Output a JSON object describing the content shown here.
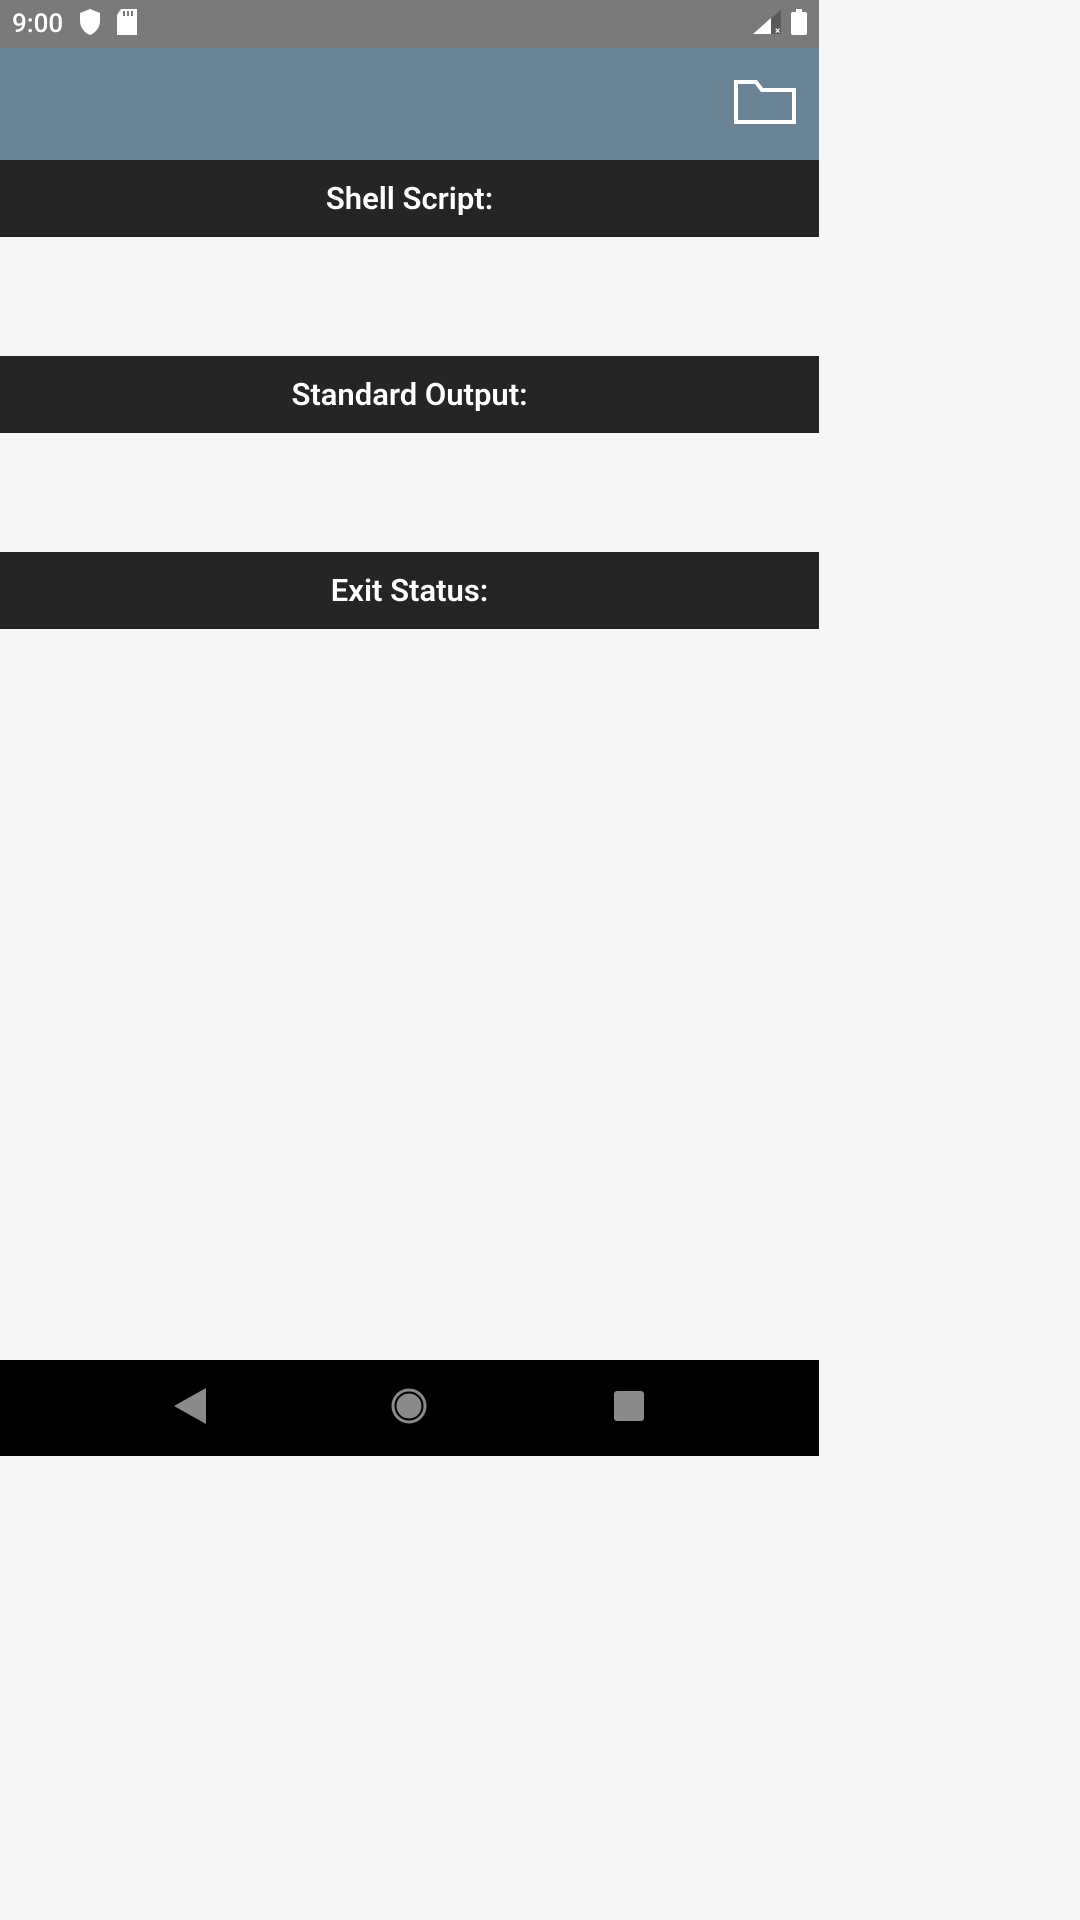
{
  "statusBar": {
    "time": "9:00"
  },
  "sections": {
    "shellScript": {
      "label": "Shell Script:"
    },
    "standardOutput": {
      "label": "Standard Output:"
    },
    "exitStatus": {
      "label": "Exit Status:"
    }
  }
}
